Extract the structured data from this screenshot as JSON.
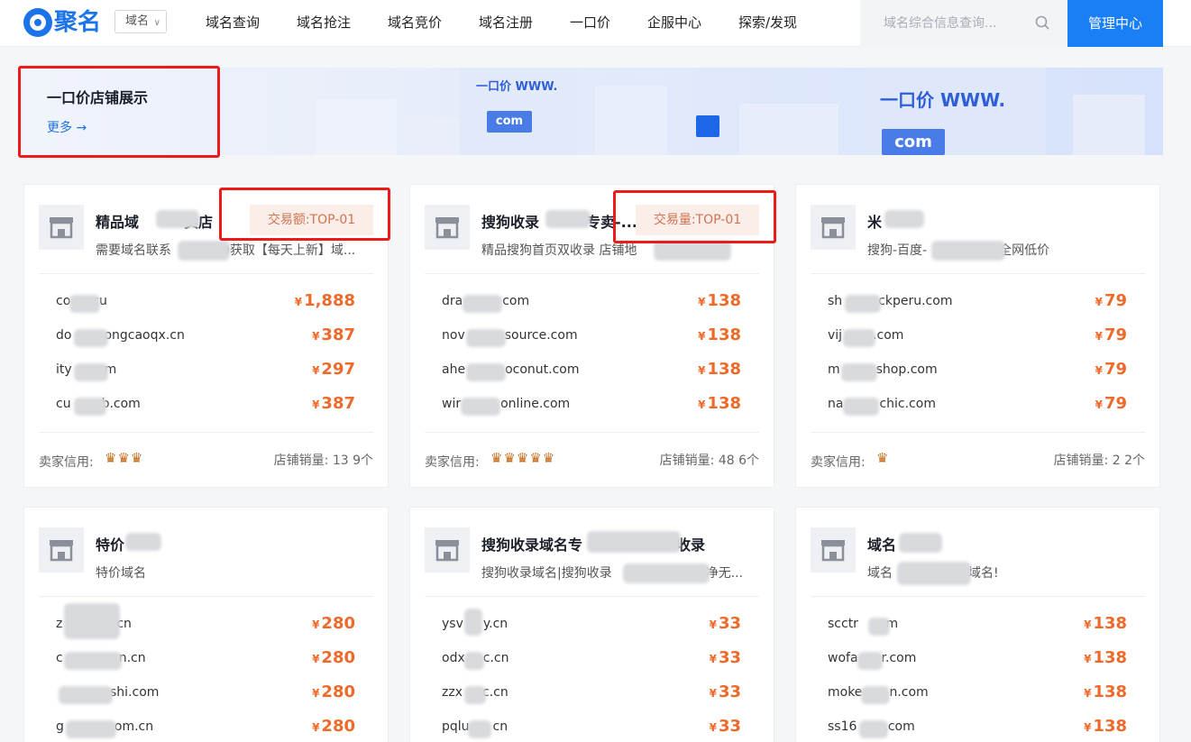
{
  "header": {
    "logo_text": "聚名",
    "dropdown_label": "域名",
    "nav": [
      "域名查询",
      "域名抢注",
      "域名竞价",
      "域名注册",
      "一口价",
      "企服中心",
      "探索/发现"
    ],
    "search_placeholder": "域名综合信息查询...",
    "manage_label": "管理中心"
  },
  "banner": {
    "title": "一口价店铺展示",
    "more": "更多 →",
    "sign1": "一口价 WWW.",
    "sign1_com": "com",
    "sign2": "一口价 WWW.",
    "sign2_com": "com"
  },
  "credit_label": "卖家信用:",
  "cards": [
    {
      "name": "精品域",
      "name_tail": "卖店",
      "desc_a": "需要域名联系",
      "desc_b": "0获取【每天上新】域...",
      "badge": "交易额:TOP-01",
      "domains": [
        {
          "n": "co",
          "t": "cu",
          "p": "1,888"
        },
        {
          "n": "do",
          "t": "ongcaoqx.cn",
          "p": "387"
        },
        {
          "n": "ity",
          "t": "m",
          "p": "297"
        },
        {
          "n": "cu",
          "t": "b.com",
          "p": "387"
        }
      ],
      "sales": "店铺销量: 13 9个",
      "crowns": "♛♛♛"
    },
    {
      "name": "搜狗收录",
      "name_tail": "专卖-...",
      "desc_a": "精品搜狗首页双收录 店铺地",
      "desc_b": "...",
      "badge": "交易量:TOP-01",
      "domains": [
        {
          "n": "dra",
          "t": "com",
          "p": "138"
        },
        {
          "n": "nov",
          "t": "source.com",
          "p": "138"
        },
        {
          "n": "ahe",
          "t": "oconut.com",
          "p": "138"
        },
        {
          "n": "wir",
          "t": "online.com",
          "p": "138"
        }
      ],
      "sales": "店铺销量: 48 6个",
      "crowns": "♛♛♛♛♛"
    },
    {
      "name": "米",
      "name_tail": "",
      "desc_a": "搜狗-百度-",
      "desc_b": "全网低价",
      "badge": "",
      "domains": [
        {
          "n": "sh",
          "t": "ckperu.com",
          "p": "79"
        },
        {
          "n": "vij",
          "t": ".com",
          "p": "79"
        },
        {
          "n": "m",
          "t": "shop.com",
          "p": "79"
        },
        {
          "n": "na",
          "t": "chic.com",
          "p": "79"
        }
      ],
      "sales": "店铺销量: 2 2个",
      "crowns": "♛"
    },
    {
      "name": "特价",
      "name_tail": "",
      "desc_a": "特价域名",
      "desc_b": "",
      "badge": "",
      "domains": [
        {
          "n": "z",
          "t": "cn",
          "p": "280"
        },
        {
          "n": "c",
          "t": "n.cn",
          "p": "280"
        },
        {
          "n": "",
          "t": "shi.com",
          "p": "280"
        },
        {
          "n": "g",
          "t": "om.cn",
          "p": "280"
        }
      ],
      "sales": "",
      "crowns": ""
    },
    {
      "name": "搜狗收录域名专",
      "name_tail": "收录",
      "desc_a": "搜狗收录域名|搜狗收录",
      "desc_b": "干净无...",
      "badge": "",
      "domains": [
        {
          "n": "ysv",
          "t": "y.cn",
          "p": "33"
        },
        {
          "n": "odx",
          "t": "c.cn",
          "p": "33"
        },
        {
          "n": "zzx",
          "t": "c.cn",
          "p": "33"
        },
        {
          "n": "pqlu",
          "t": "cn",
          "p": "33"
        }
      ],
      "sales": "",
      "crowns": ""
    },
    {
      "name": "域名",
      "name_tail": "",
      "desc_a": "域名",
      "desc_b": "域名!",
      "badge": "",
      "domains": [
        {
          "n": "scctr",
          "t": "om",
          "p": "138"
        },
        {
          "n": "wofa",
          "t": "r.com",
          "p": "138"
        },
        {
          "n": "moke",
          "t": "n.com",
          "p": "138"
        },
        {
          "n": "ss16",
          "t": ".com",
          "p": "138"
        }
      ],
      "sales": "",
      "crowns": ""
    }
  ]
}
